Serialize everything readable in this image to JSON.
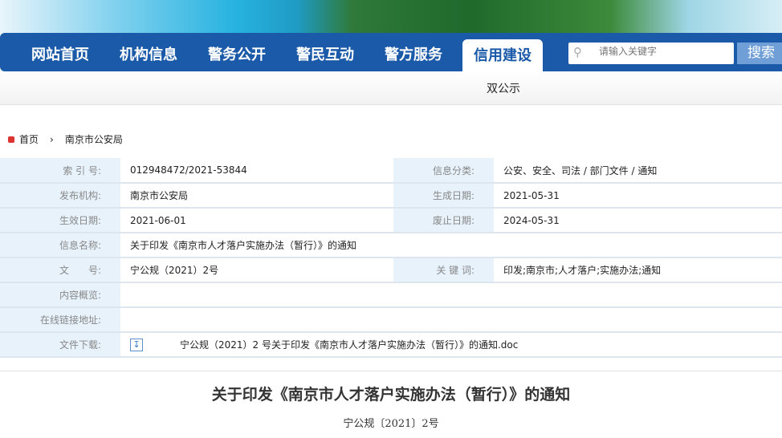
{
  "nav": {
    "items": [
      "网站首页",
      "机构信息",
      "警务公开",
      "警民互动",
      "警方服务",
      "信用建设"
    ],
    "active": 5
  },
  "search": {
    "placeholder": "请输入关键字",
    "button": "搜索"
  },
  "subnav": {
    "item": "双公示"
  },
  "breadcrumb": {
    "home": "首页",
    "current": "南京市公安局"
  },
  "info": {
    "index_label": "索 引 号:",
    "index": "012948472/2021-53844",
    "category_label": "信息分类:",
    "category": "公安、安全、司法 / 部门文件 / 通知",
    "publisher_label": "发布机构:",
    "publisher": "南京市公安局",
    "created_label": "生成日期:",
    "created": "2021-05-31",
    "effective_label": "生效日期:",
    "effective": "2021-06-01",
    "expire_label": "废止日期:",
    "expire": "2024-05-31",
    "name_label": "信息名称:",
    "name": "关于印发《南京市人才落户实施办法（暂行）》的通知",
    "docno_label": "文　　号:",
    "docno": "宁公规（2021）2号",
    "keywords_label": "关 键 词:",
    "keywords": "印发;南京市;人才落户;实施办法;通知",
    "summary_label": "内容概览:",
    "link_label": "在线链接地址:",
    "download_label": "文件下载:",
    "download": "宁公规（2021）2 号关于印发《南京市人才落户实施办法（暂行）》的通知.doc"
  },
  "article": {
    "title": "关于印发《南京市人才落户实施办法（暂行）》的通知",
    "docno": "宁公规〔2021〕2号"
  }
}
